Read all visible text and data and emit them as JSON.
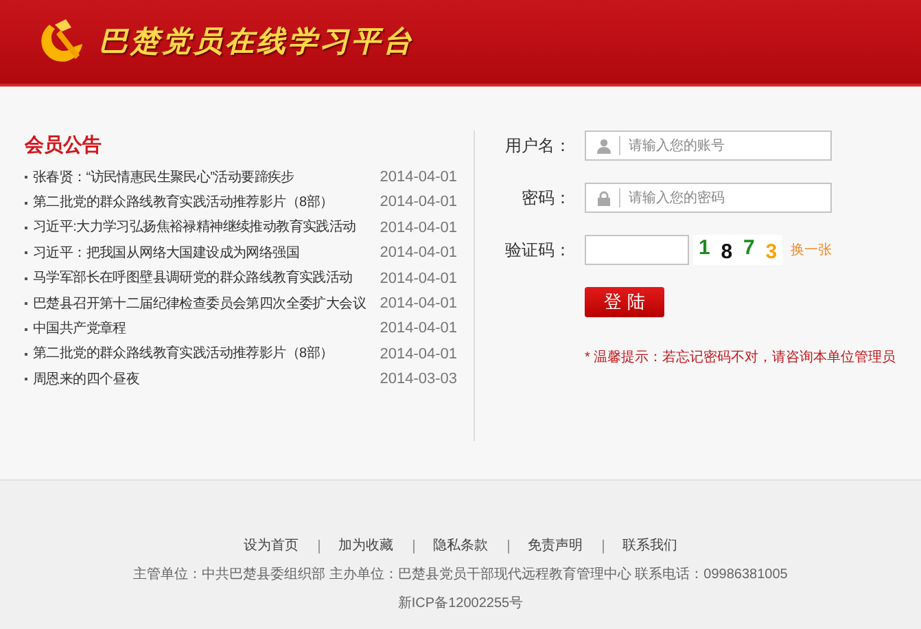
{
  "header": {
    "title": "巴楚党员在线学习平台"
  },
  "notices": {
    "title": "会员公告",
    "items": [
      {
        "title": "张春贤：“访民情惠民生聚民心”活动要蹄疾步",
        "date": "2014-04-01"
      },
      {
        "title": "第二批党的群众路线教育实践活动推荐影片（8部）",
        "date": "2014-04-01"
      },
      {
        "title": "习近平:大力学习弘扬焦裕禄精神继续推动教育实践活动",
        "date": "2014-04-01"
      },
      {
        "title": "习近平：把我国从网络大国建设成为网络强国",
        "date": "2014-04-01"
      },
      {
        "title": "马学军部长在呼图壁县调研党的群众路线教育实践活动",
        "date": "2014-04-01"
      },
      {
        "title": "巴楚县召开第十二届纪律检查委员会第四次全委扩大会议",
        "date": "2014-04-01"
      },
      {
        "title": "中国共产党章程",
        "date": "2014-04-01"
      },
      {
        "title": "第二批党的群众路线教育实践活动推荐影片（8部）",
        "date": "2014-04-01"
      },
      {
        "title": "周恩来的四个昼夜",
        "date": "2014-03-03"
      }
    ]
  },
  "login": {
    "fields": [
      {
        "kind": "user",
        "label": "用户名：",
        "placeholder": "请输入您的账号"
      },
      {
        "kind": "password",
        "label": "密码：",
        "placeholder": "请输入您的密码"
      }
    ],
    "captcha": {
      "label": "验证码：",
      "digits": [
        {
          "text": "1",
          "color": "#1e8a1e"
        },
        {
          "text": "8",
          "color": "#111111"
        },
        {
          "text": "7",
          "color": "#1e8a1e"
        },
        {
          "text": "3",
          "color": "#f5a300"
        }
      ],
      "refresh": "换一张"
    },
    "submit": "登 陆",
    "tip": "* 温馨提示：若忘记密码不对，请咨询本单位管理员"
  },
  "footer": {
    "links": [
      "设为首页",
      "加为收藏",
      "隐私条款",
      "免责声明",
      "联系我们"
    ],
    "info": "主管单位：中共巴楚县委组织部 主办单位：巴楚县党员干部现代远程教育管理中心 联系电话：09986381005",
    "icp": "新ICP备12002255号"
  }
}
